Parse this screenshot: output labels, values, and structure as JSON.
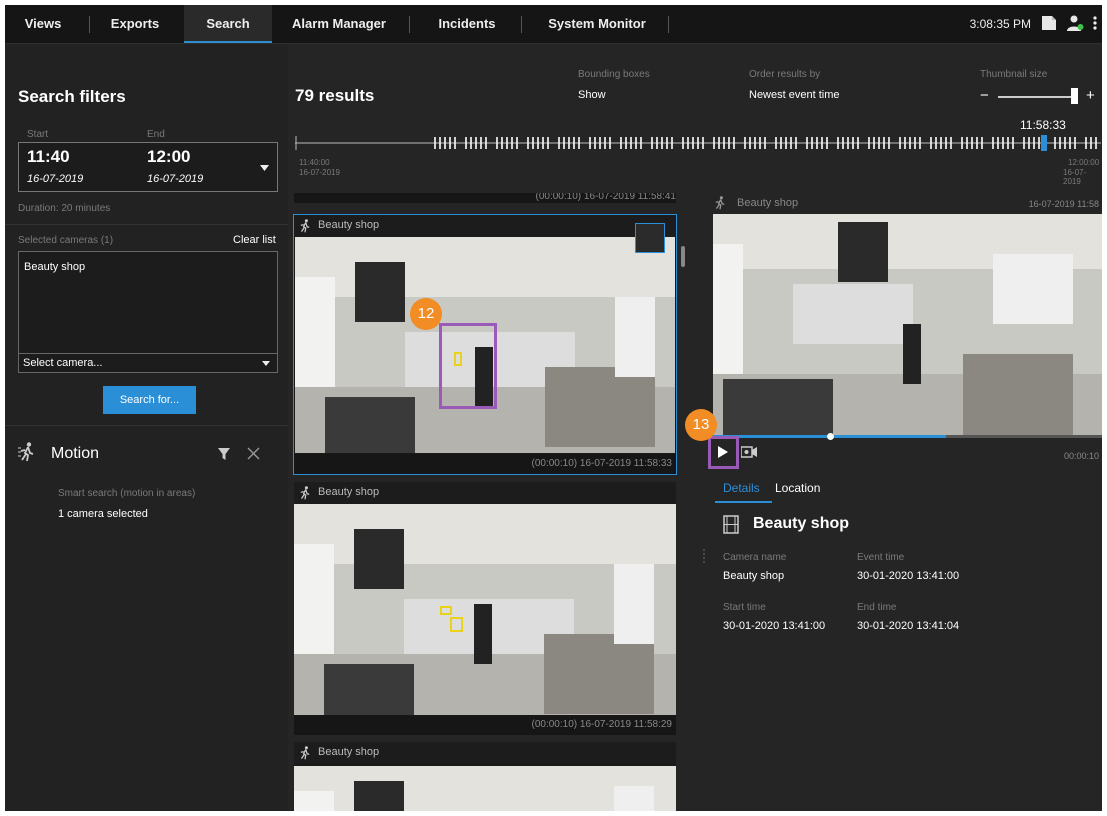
{
  "topbar": {
    "tabs": [
      "Views",
      "Exports",
      "Search",
      "Alarm Manager",
      "Incidents",
      "System Monitor"
    ],
    "active_tab": "Search",
    "clock": "3:08:35 PM"
  },
  "filters": {
    "title": "Search filters",
    "start_label": "Start",
    "end_label": "End",
    "start_time": "11:40",
    "start_date": "16-07-2019",
    "end_time": "12:00",
    "end_date": "16-07-2019",
    "duration": "Duration: 20 minutes",
    "selected_cameras_label": "Selected cameras (1)",
    "clear_list": "Clear list",
    "camera_item": "Beauty shop",
    "select_camera": "Select camera...",
    "search_button": "Search for..."
  },
  "motion": {
    "title": "Motion",
    "desc": "Smart search (motion in areas)",
    "cameras": "1 camera selected"
  },
  "results": {
    "count": "79 results",
    "bbox_label": "Bounding boxes",
    "bbox_value": "Show",
    "order_label": "Order results by",
    "order_value": "Newest event time",
    "thumb_label": "Thumbnail size",
    "thumb_minus": "−",
    "thumb_plus": "+"
  },
  "timeline": {
    "current": "11:58:33",
    "start_time": "11:40:00",
    "start_date": "16-07-2019",
    "end_time": "12:00:00",
    "end_date": "16-07-2019"
  },
  "thumbnails": [
    {
      "camera": "Beauty shop",
      "footer": "(00:00:10)   16-07-2019 11:58:33"
    },
    {
      "camera": "Beauty shop",
      "footer": "(00:00:10)   16-07-2019 11:58:29"
    },
    {
      "camera": "Beauty shop",
      "footer": ""
    }
  ],
  "top_partial_footer": "(00:00:10)   16-07-2019 11:58:41",
  "preview": {
    "camera": "Beauty shop",
    "timestamp": "16-07-2019 11:58",
    "duration": "00:00:10",
    "progress": 0.6
  },
  "details": {
    "tab_details": "Details",
    "tab_location": "Location",
    "title": "Beauty shop",
    "camera_name_label": "Camera name",
    "camera_name": "Beauty shop",
    "event_time_label": "Event time",
    "event_time": "30-01-2020 13:41:00",
    "start_time_label": "Start time",
    "start_time": "30-01-2020 13:41:00",
    "end_time_label": "End time",
    "end_time": "30-01-2020 13:41:04"
  },
  "callouts": [
    "12",
    "13"
  ],
  "colors": {
    "accent": "#2b8fd8",
    "callout": "#f28c24",
    "marker": "#9a5bb8",
    "bbox": "#e8d21a"
  }
}
